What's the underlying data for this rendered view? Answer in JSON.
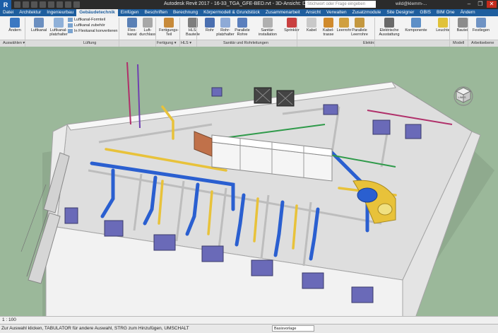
{
  "app": {
    "logo": "R",
    "title": "Autodesk Revit 2017 -   16-33_TGA_GFE-BED.rvt - 3D-Ansicht: Deckel_a...",
    "search_placeholder": "Stichwort oder Frage eingeben",
    "user": "wild@klemm-...",
    "window_buttons": [
      "–",
      "❐",
      "✕"
    ]
  },
  "tabs": [
    {
      "label": "Datei"
    },
    {
      "label": "Architektur"
    },
    {
      "label": "Ingenieurbau"
    },
    {
      "label": "Gebäudetechnik",
      "active": true
    },
    {
      "label": "Einfügen"
    },
    {
      "label": "Beschriften"
    },
    {
      "label": "Berechnung"
    },
    {
      "label": "Körpermodell & Grundstück"
    },
    {
      "label": "Zusammenarbeit"
    },
    {
      "label": "Ansicht"
    },
    {
      "label": "Verwalten"
    },
    {
      "label": "Zusatzmodule"
    },
    {
      "label": "Site Designer"
    },
    {
      "label": "GBIS"
    },
    {
      "label": "BIM One"
    },
    {
      "label": "Ändern"
    }
  ],
  "ribbon": {
    "buttons": [
      {
        "label": "Ändern",
        "color": "#3b78c2"
      },
      {
        "label": "Luftkanal",
        "color": "#6b8fc0"
      },
      {
        "label": "Luftkanal-\nplatzhalter",
        "color": "#8fb0d8"
      },
      {
        "label": "Flex-\nkanal",
        "color": "#5a80b5"
      },
      {
        "label": "Luft-\ndurchlass",
        "color": "#a7a7a7"
      },
      {
        "label": "Fertigungs-\nTeil",
        "color": "#c78a3a"
      },
      {
        "label": "HLS-\nBauteile",
        "color": "#7e7e7e"
      },
      {
        "label": "Rohr",
        "color": "#4a6fb0"
      },
      {
        "label": "Rohr-\nplatzhalter",
        "color": "#8eaad6"
      },
      {
        "label": "Parallele\nRohre",
        "color": "#5b7fbd"
      },
      {
        "label": "Sanitär-\ninstallation",
        "color": "#b0b0b0"
      },
      {
        "label": "Sprinkler",
        "color": "#c94040"
      },
      {
        "label": "Kabel",
        "color": "#c9c9c9"
      },
      {
        "label": "Kabel-\ntrasse",
        "color": "#d08a2c"
      },
      {
        "label": "Leerrohr",
        "color": "#d0a040"
      },
      {
        "label": "Parallele\nLeerrohre",
        "color": "#c49840"
      },
      {
        "label": "Elektrische\nAusstattung",
        "color": "#6a6a6a"
      },
      {
        "label": "Komponente",
        "color": "#5d8fc7"
      },
      {
        "label": "Leuchte",
        "color": "#e0c23a"
      },
      {
        "label": "Bauteil",
        "color": "#8c8c8c"
      },
      {
        "label": "Festlegen",
        "color": "#6f93c4"
      }
    ],
    "small_commands": [
      "Luftkanal-Formteil",
      "Luftkanal zubehör",
      "In Flexkanal konvertieren"
    ],
    "panels": [
      "Auswählen ▾",
      "Lüftung",
      "Fertigung ▾",
      "HLS ▾",
      "Sanitär und Rohrleitungen",
      "Elektro",
      "Modell",
      "Arbeitsebene"
    ]
  },
  "viewcube": {
    "label": "LINKS"
  },
  "viewbar": {
    "scale": "1 : 100"
  },
  "status": {
    "text": "Zur Auswahl klicken, TABULATOR für andere Auswahl, STRG zum Hinzufügen, UMSCHALT",
    "field": "Basisvorlage"
  },
  "colors": {
    "tab_bar": "#1e5e9e",
    "viewport_bg": "#9bb89a",
    "duct_blue": "#2a5fd0",
    "pipe_yellow": "#e8c23a",
    "pipe_magenta": "#b0306a",
    "pipe_green": "#2f9a4a"
  }
}
